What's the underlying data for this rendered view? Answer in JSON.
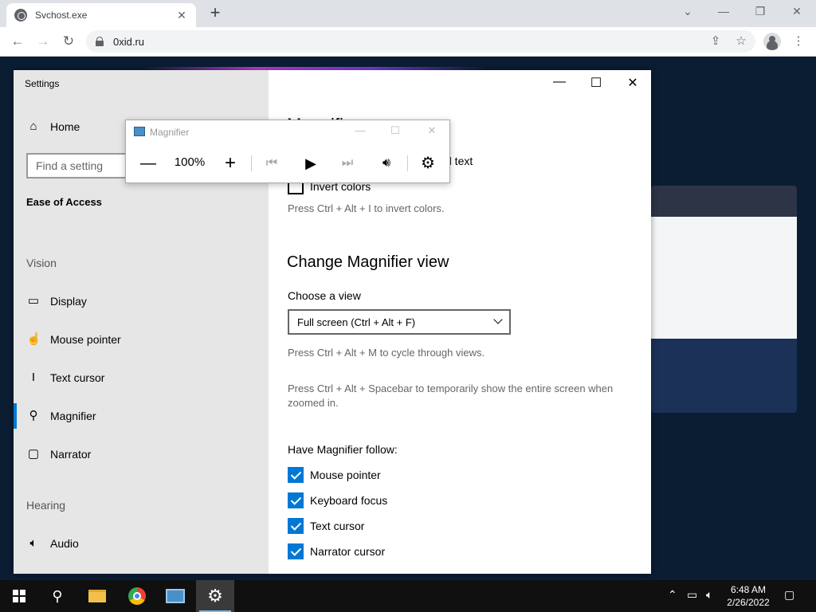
{
  "browser": {
    "tab_title": "Svchost.exe",
    "url": "0xid.ru"
  },
  "settings": {
    "title": "Settings",
    "nav": {
      "home": "Home",
      "search_placeholder": "Find a setting",
      "section": "Ease of Access",
      "vision_head": "Vision",
      "items": [
        {
          "label": "Display",
          "icon": "monitor-icon"
        },
        {
          "label": "Mouse pointer",
          "icon": "mouse-pointer-icon"
        },
        {
          "label": "Text cursor",
          "icon": "text-cursor-icon"
        },
        {
          "label": "Magnifier",
          "icon": "magnifier-icon",
          "active": true
        },
        {
          "label": "Narrator",
          "icon": "narrator-icon"
        }
      ],
      "hearing_head": "Hearing",
      "audio": "Audio"
    },
    "content": {
      "partial_heading": "Magnifier",
      "partial_text": "d text",
      "invert_colors": "Invert colors",
      "invert_hint": "Press Ctrl + Alt + I to invert colors.",
      "view_heading": "Change Magnifier view",
      "choose_view_label": "Choose a view",
      "view_value": "Full screen (Ctrl + Alt + F)",
      "cycle_hint": "Press Ctrl + Alt + M to cycle through views.",
      "spacebar_hint": "Press Ctrl + Alt + Spacebar to temporarily show the entire screen when zoomed in.",
      "follow_label": "Have Magnifier follow:",
      "follow_options": [
        {
          "label": "Mouse pointer",
          "checked": true
        },
        {
          "label": "Keyboard focus",
          "checked": true
        },
        {
          "label": "Text cursor",
          "checked": true
        },
        {
          "label": "Narrator cursor",
          "checked": true
        }
      ]
    }
  },
  "magnifier": {
    "title": "Magnifier",
    "zoom": "100%"
  },
  "taskbar": {
    "time": "6:48 AM",
    "date": "2/26/2022"
  },
  "colors": {
    "accent": "#0078d4",
    "page_bg": "#0b1d33"
  }
}
